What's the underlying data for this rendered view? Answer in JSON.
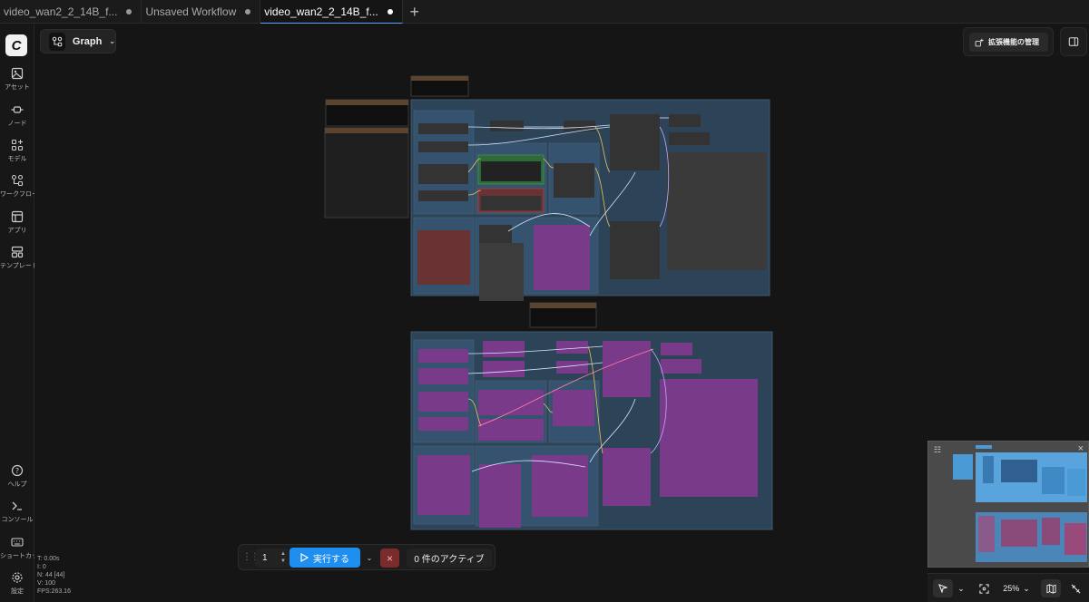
{
  "tabs": [
    {
      "label": "video_wan2_2_14B_f...",
      "modified": true
    },
    {
      "label": "Unsaved Workflow",
      "modified": true
    },
    {
      "label": "video_wan2_2_14B_f...",
      "modified": true,
      "active": true
    }
  ],
  "sidebar": {
    "items": [
      {
        "label": "アセット",
        "icon": "image-icon"
      },
      {
        "label": "ノード",
        "icon": "node-icon"
      },
      {
        "label": "モデル",
        "icon": "model-icon"
      },
      {
        "label": "ワークフロー",
        "icon": "workflow-icon"
      },
      {
        "label": "アプリ",
        "icon": "app-icon"
      },
      {
        "label": "テンプレート",
        "icon": "template-icon"
      }
    ],
    "bottom_items": [
      {
        "label": "ヘルプ",
        "icon": "help-icon"
      },
      {
        "label": "コンソール",
        "icon": "console-icon"
      },
      {
        "label": "ショートカット",
        "icon": "keyboard-icon"
      },
      {
        "label": "設定",
        "icon": "settings-icon"
      }
    ]
  },
  "stats": [
    "T: 0.00s",
    "I: 0",
    "N: 44 [44]",
    "V: 100",
    "FPS:263.16"
  ],
  "toolbar": {
    "graph_label": "Graph"
  },
  "extensions": {
    "label": "拡張機能の管理"
  },
  "runbar": {
    "count": "1",
    "run_label": "実行する",
    "active_label": "0 件のアクティブ"
  },
  "canvas_tools": {
    "zoom": "25%"
  },
  "colors": {
    "accent": "#1e8ef0",
    "group_blue": "#3a5a7a",
    "node_purple": "#7a3a8a",
    "cancel_red": "#7a2b2b"
  }
}
